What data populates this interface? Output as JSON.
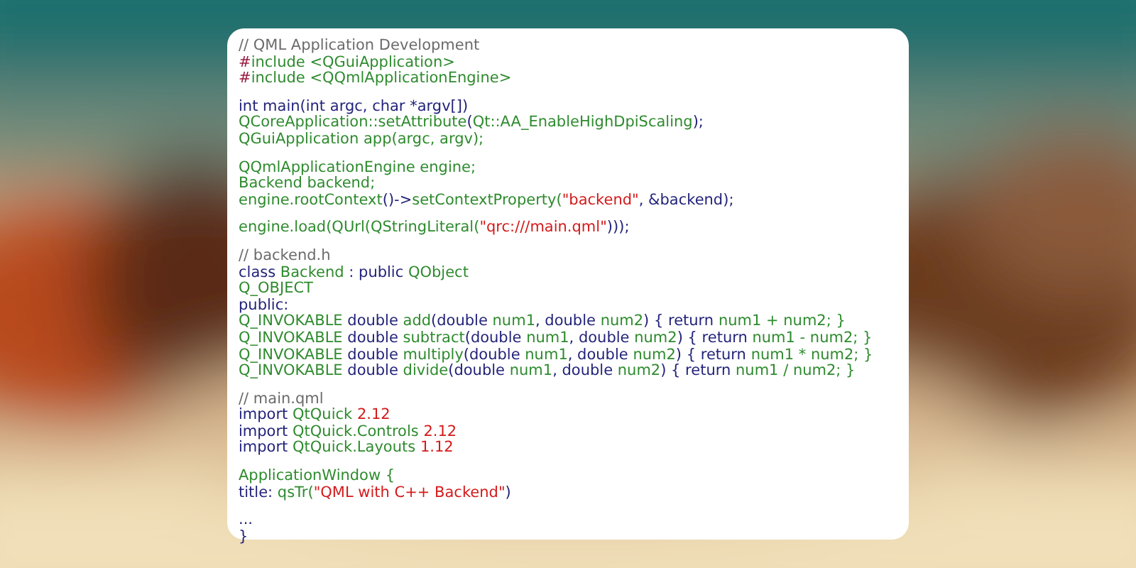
{
  "code_card": {
    "blocks": [
      {
        "lines": [
          [
            {
              "text": "// QML Application Development",
              "kind": "comment"
            }
          ],
          [
            {
              "text": "#",
              "kind": "preproc"
            },
            {
              "text": "include <QGuiApplication>",
              "kind": "type"
            }
          ],
          [
            {
              "text": "#",
              "kind": "preproc"
            },
            {
              "text": "include <QQmlApplicationEngine>",
              "kind": "type"
            }
          ]
        ]
      },
      {
        "lines": [
          [
            {
              "text": "int main(int argc, char *argv[])",
              "kind": "keyword"
            }
          ],
          [
            {
              "text": "QCoreApplication::setAttribute",
              "kind": "type"
            },
            {
              "text": "(",
              "kind": "keyword"
            },
            {
              "text": "Qt::AA_EnableHighDpiScaling",
              "kind": "type"
            },
            {
              "text": ");",
              "kind": "keyword"
            }
          ],
          [
            {
              "text": "QGuiApplication app(argc, argv);",
              "kind": "type"
            }
          ]
        ]
      },
      {
        "lines": [
          [
            {
              "text": "QQmlApplicationEngine engine;",
              "kind": "type"
            }
          ],
          [
            {
              "text": "Backend backend;",
              "kind": "type"
            }
          ],
          [
            {
              "text": "engine.rootContext",
              "kind": "type"
            },
            {
              "text": "()->",
              "kind": "keyword"
            },
            {
              "text": "setContextProperty(",
              "kind": "type"
            },
            {
              "text": "\"backend\"",
              "kind": "string"
            },
            {
              "text": ", &backend);",
              "kind": "keyword"
            }
          ]
        ]
      },
      {
        "lines": [
          [
            {
              "text": "engine.load(QUrl(QStringLiteral(",
              "kind": "type"
            },
            {
              "text": "\"qrc:///main.qml\"",
              "kind": "string"
            },
            {
              "text": ")));",
              "kind": "keyword"
            }
          ]
        ]
      },
      {
        "lines": [
          [
            {
              "text": "// backend.h",
              "kind": "comment"
            }
          ],
          [
            {
              "text": "class",
              "kind": "keyword"
            },
            {
              "text": " Backend",
              "kind": "type"
            },
            {
              "text": " : public ",
              "kind": "keyword"
            },
            {
              "text": "QObject",
              "kind": "type"
            }
          ],
          [
            {
              "text": "Q_OBJECT",
              "kind": "type"
            }
          ],
          [
            {
              "text": "public:",
              "kind": "keyword"
            }
          ],
          [
            {
              "text": "Q_INVOKABLE",
              "kind": "type"
            },
            {
              "text": " double ",
              "kind": "keyword"
            },
            {
              "text": "add",
              "kind": "type"
            },
            {
              "text": "(double ",
              "kind": "keyword"
            },
            {
              "text": "num1",
              "kind": "type"
            },
            {
              "text": ", double ",
              "kind": "keyword"
            },
            {
              "text": "num2",
              "kind": "type"
            },
            {
              "text": ") { return ",
              "kind": "keyword"
            },
            {
              "text": "num1 + num2; }",
              "kind": "type"
            }
          ],
          [
            {
              "text": "Q_INVOKABLE",
              "kind": "type"
            },
            {
              "text": " double ",
              "kind": "keyword"
            },
            {
              "text": "subtract",
              "kind": "type"
            },
            {
              "text": "(double ",
              "kind": "keyword"
            },
            {
              "text": "num1",
              "kind": "type"
            },
            {
              "text": ", double ",
              "kind": "keyword"
            },
            {
              "text": "num2",
              "kind": "type"
            },
            {
              "text": ") { return ",
              "kind": "keyword"
            },
            {
              "text": "num1 - num2; }",
              "kind": "type"
            }
          ],
          [
            {
              "text": "Q_INVOKABLE",
              "kind": "type"
            },
            {
              "text": " double ",
              "kind": "keyword"
            },
            {
              "text": "multiply",
              "kind": "type"
            },
            {
              "text": "(double ",
              "kind": "keyword"
            },
            {
              "text": "num1",
              "kind": "type"
            },
            {
              "text": ", double ",
              "kind": "keyword"
            },
            {
              "text": "num2",
              "kind": "type"
            },
            {
              "text": ") { return ",
              "kind": "keyword"
            },
            {
              "text": "num1 * num2; }",
              "kind": "type"
            }
          ],
          [
            {
              "text": "Q_INVOKABLE",
              "kind": "type"
            },
            {
              "text": " double ",
              "kind": "keyword"
            },
            {
              "text": "divide",
              "kind": "type"
            },
            {
              "text": "(double ",
              "kind": "keyword"
            },
            {
              "text": "num1",
              "kind": "type"
            },
            {
              "text": ", double ",
              "kind": "keyword"
            },
            {
              "text": "num2",
              "kind": "type"
            },
            {
              "text": ") { return ",
              "kind": "keyword"
            },
            {
              "text": "num1 / num2; }",
              "kind": "type"
            }
          ]
        ]
      },
      {
        "lines": [
          [
            {
              "text": "// main.qml",
              "kind": "comment"
            }
          ],
          [
            {
              "text": "import ",
              "kind": "keyword"
            },
            {
              "text": "QtQuick ",
              "kind": "type"
            },
            {
              "text": "2.12",
              "kind": "string"
            }
          ],
          [
            {
              "text": "import ",
              "kind": "keyword"
            },
            {
              "text": "QtQuick.Controls ",
              "kind": "type"
            },
            {
              "text": "2.12",
              "kind": "string"
            }
          ],
          [
            {
              "text": "import ",
              "kind": "keyword"
            },
            {
              "text": "QtQuick.Layouts ",
              "kind": "type"
            },
            {
              "text": "1.12",
              "kind": "string"
            }
          ]
        ]
      },
      {
        "lines": [
          [
            {
              "text": "ApplicationWindow {",
              "kind": "type"
            }
          ],
          [
            {
              "text": "title: ",
              "kind": "keyword"
            },
            {
              "text": "qsTr(",
              "kind": "type"
            },
            {
              "text": "\"QML with C++ Backend\"",
              "kind": "string"
            },
            {
              "text": ")",
              "kind": "keyword"
            }
          ]
        ]
      },
      {
        "lines": [
          [
            {
              "text": "...",
              "kind": "keyword"
            }
          ],
          [
            {
              "text": "}",
              "kind": "keyword"
            }
          ]
        ]
      }
    ]
  }
}
